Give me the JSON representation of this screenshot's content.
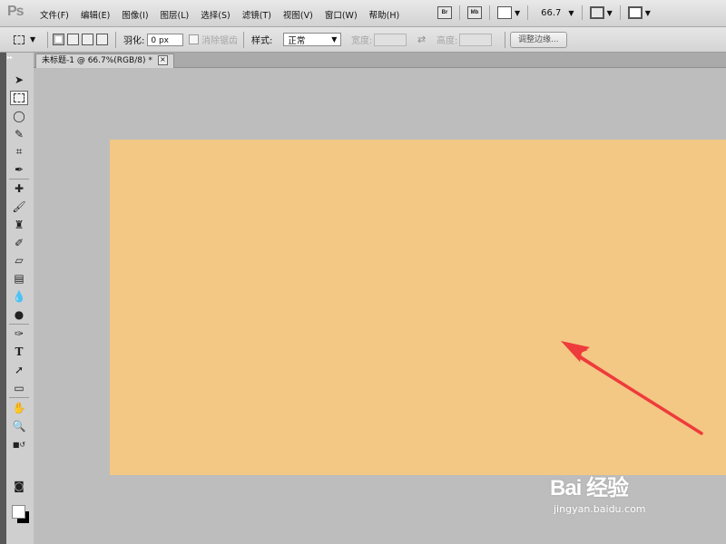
{
  "app": {
    "logo": "Ps"
  },
  "menubar": {
    "items": [
      "文件(F)",
      "编辑(E)",
      "图像(I)",
      "图层(L)",
      "选择(S)",
      "滤镜(T)",
      "视图(V)",
      "窗口(W)",
      "帮助(H)"
    ],
    "bridge_label": "Br",
    "minibridge_label": "Mb",
    "zoom_value": "66.7"
  },
  "options": {
    "feather_label": "羽化:",
    "feather_value": "0 px",
    "antialias_label": "消除锯齿",
    "style_label": "样式:",
    "style_value": "正常",
    "width_label": "宽度:",
    "height_label": "高度:",
    "refine_edge_label": "调整边缘..."
  },
  "document": {
    "tab_title": "未标题-1 @ 66.7%(RGB/8) *",
    "canvas_color": "#f3c784",
    "annotation_color": "#ee3b3b"
  },
  "watermark": {
    "brand": "Bai 经验",
    "url": "jingyan.baidu.com"
  }
}
